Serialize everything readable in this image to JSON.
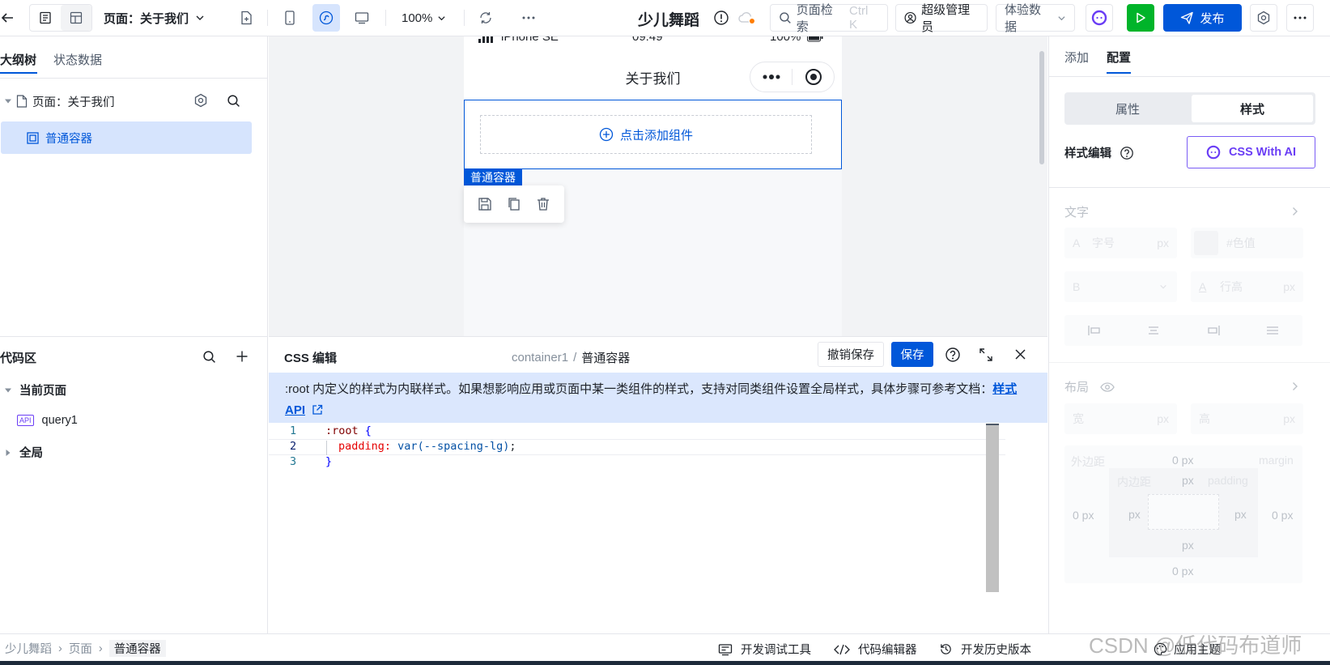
{
  "topbar": {
    "page_selector": "页面：关于我们",
    "zoom": "100%",
    "app_name": "少儿舞蹈",
    "search_placeholder": "页面检索",
    "search_shortcut": "Ctrl K",
    "user_role": "超级管理员",
    "data_env": "体验数据",
    "publish_label": "发布"
  },
  "outline": {
    "tabs": [
      "大纲树",
      "状态数据"
    ],
    "page_node": "页面：关于我们",
    "container_node": "普通容器"
  },
  "code_area": {
    "title": "代码区",
    "current_page": "当前页面",
    "query": "query1",
    "query_badge": "API",
    "global": "全局"
  },
  "phone": {
    "device": "iPhone SE",
    "time": "09:49",
    "battery": "100%",
    "page_title": "关于我们",
    "add_component": "点击添加组件",
    "selected_label": "普通容器"
  },
  "css_editor": {
    "title": "CSS 编辑",
    "path_id": "container1",
    "path_sep": "/",
    "path_name": "普通容器",
    "revert_label": "撤销保存",
    "save_label": "保存",
    "notice": ":root 内定义的样式为内联样式。如果想影响应用或页面中某一类组件的样式，支持对同类组件设置全局样式，具体步骤可参考文档：",
    "notice_link_1": "样式",
    "notice_link_2": "API",
    "lines": [
      {
        "no": "1",
        "selector": ":root",
        "open": " {"
      },
      {
        "no": "2",
        "prop": "padding",
        "colon": ": ",
        "fn": "var",
        "paren_open": "(",
        "arg": "--spacing-lg",
        "paren_close": ")",
        "semi": ";"
      },
      {
        "no": "3",
        "close": "}"
      }
    ]
  },
  "right_panel": {
    "tabs": [
      "添加",
      "配置"
    ],
    "seg": [
      "属性",
      "样式"
    ],
    "style_edit": "样式编辑",
    "ai_button": "CSS With AI",
    "text_section": "文字",
    "font_size_ph": "字号",
    "color_ph": "#色值",
    "line_height_ph": "行高",
    "unit": "px",
    "layout_section": "布局",
    "width_label": "宽",
    "height_label": "高",
    "margin_label": "外边距",
    "margin_en": "margin",
    "padding_label": "内边距",
    "padding_en": "padding",
    "zero_px": "0 px"
  },
  "statusbar": {
    "breadcrumb": [
      "少儿舞蹈",
      "页面",
      "普通容器"
    ],
    "dev_tools": "开发调试工具",
    "code_editor": "代码编辑器",
    "history": "开发历史版本",
    "theme": "应用主题",
    "watermark": "CSDN @低代码布道师"
  },
  "colors": {
    "accent": "#0057d9",
    "run_green": "#00b42a",
    "notice_bg": "#dbe7fd",
    "selection": "#d6e4fd"
  }
}
